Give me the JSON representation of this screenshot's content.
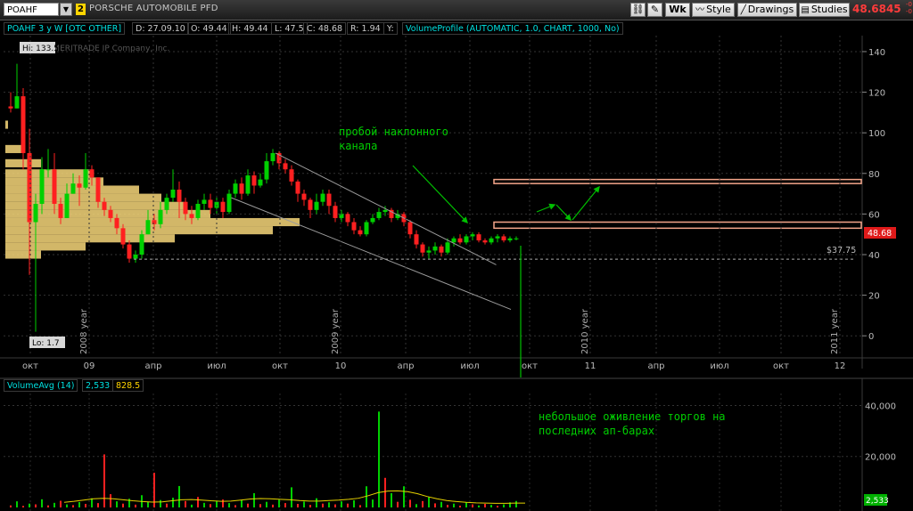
{
  "toolbar": {
    "symbol": "POAHF",
    "link_number": "2",
    "company_name": "PORSCHE AUTOMOBILE PFD",
    "buttons": {
      "wk": "Wk",
      "style": "Style",
      "drawings": "Drawings",
      "studies": "Studies"
    },
    "last_price": "48.6845",
    "change_small_top": "-0",
    "change_small_bottom": "-0"
  },
  "infobar": {
    "symbol_label": "POAHF 3 y W [OTC OTHER]",
    "date": "D: 27.09.10",
    "open": "O: 49.44",
    "high": "H: 49.44",
    "low": "L: 47.5",
    "close": "C: 48.68",
    "range": "R: 1.94",
    "y": "Y:",
    "study": "VolumeProfile (AUTOMATIC, 1.0, CHART, 1000, No)"
  },
  "colors": {
    "up": "#00d000",
    "down": "#ff2020",
    "profile": "#f7d77a",
    "channel": "#9a9a9a",
    "arrow": "#00c000",
    "zone": "#f4a58a"
  },
  "chart_data": [
    {
      "type": "candlestick",
      "title": "",
      "watermark": "© TD AMERITRADE IP Company, Inc.",
      "y_axis": {
        "ticks": [
          0,
          20,
          40,
          60,
          80,
          100,
          120,
          140
        ],
        "ylim": [
          -10,
          147
        ],
        "side": "right"
      },
      "x_axis": {
        "tick_labels": [
          "окт",
          "09",
          "апр",
          "июл",
          "окт",
          "10",
          "апр",
          "июл",
          "окт",
          "11",
          "апр",
          "июл",
          "окт",
          "12"
        ],
        "year_labels": [
          "2008 year",
          "2009 year",
          "2010 year",
          "2011 year"
        ]
      },
      "hi_label": "Hi: 133.5",
      "lo_label": "Lo: 1.7",
      "price_label": "48.68",
      "support_label": "$37.75",
      "support_value": 37.75,
      "channel_upper": {
        "from": [
          90,
          90
        ],
        "to": [
          165,
          35
        ]
      },
      "channel_lower": {
        "from": [
          75,
          68
        ],
        "to": [
          170,
          13
        ]
      },
      "resistance_zones": [
        [
          75,
          77
        ],
        [
          53,
          56
        ]
      ],
      "annotation_1": "пробой наклонного",
      "annotation_2": "канала",
      "candles": [
        [
          113,
          112,
          120,
          110
        ],
        [
          112,
          118,
          134,
          112
        ],
        [
          118,
          90,
          122,
          82
        ],
        [
          90,
          56,
          102,
          30
        ],
        [
          56,
          65,
          70,
          2
        ],
        [
          65,
          82,
          88,
          60
        ],
        [
          82,
          82,
          92,
          78
        ],
        [
          82,
          65,
          90,
          60
        ],
        [
          65,
          58,
          68,
          55
        ],
        [
          58,
          70,
          75,
          58
        ],
        [
          70,
          75,
          80,
          70
        ],
        [
          75,
          73,
          79,
          64
        ],
        [
          73,
          82,
          90,
          72
        ],
        [
          82,
          78,
          84,
          74
        ],
        [
          78,
          66,
          78,
          63
        ],
        [
          66,
          62,
          68,
          59
        ],
        [
          62,
          58,
          64,
          56
        ],
        [
          58,
          53,
          60,
          50
        ],
        [
          53,
          45,
          55,
          43
        ],
        [
          45,
          38,
          47,
          36
        ],
        [
          38,
          40,
          42,
          36
        ],
        [
          40,
          50,
          52,
          38
        ],
        [
          50,
          57,
          62,
          50
        ],
        [
          57,
          55,
          60,
          52
        ],
        [
          55,
          62,
          66,
          53
        ],
        [
          62,
          68,
          70,
          60
        ],
        [
          68,
          72,
          82,
          66
        ],
        [
          72,
          66,
          76,
          58
        ],
        [
          66,
          60,
          68,
          57
        ],
        [
          60,
          58,
          64,
          55
        ],
        [
          58,
          65,
          67,
          57
        ],
        [
          65,
          67,
          70,
          62
        ],
        [
          67,
          63,
          70,
          60
        ],
        [
          63,
          66,
          69,
          60
        ],
        [
          66,
          61,
          68,
          58
        ],
        [
          61,
          70,
          72,
          60
        ],
        [
          70,
          75,
          77,
          68
        ],
        [
          75,
          70,
          78,
          67
        ],
        [
          70,
          79,
          82,
          69
        ],
        [
          79,
          74,
          81,
          70
        ],
        [
          74,
          77,
          80,
          73
        ],
        [
          77,
          86,
          90,
          75
        ],
        [
          86,
          90,
          92,
          84
        ],
        [
          90,
          85,
          91,
          82
        ],
        [
          85,
          82,
          87,
          80
        ],
        [
          82,
          76,
          84,
          74
        ],
        [
          76,
          70,
          77,
          66
        ],
        [
          70,
          67,
          72,
          64
        ],
        [
          67,
          62,
          68,
          58
        ],
        [
          62,
          66,
          70,
          60
        ],
        [
          66,
          70,
          72,
          64
        ],
        [
          70,
          64,
          72,
          60
        ],
        [
          64,
          58,
          66,
          56
        ],
        [
          58,
          60,
          62,
          56
        ],
        [
          60,
          56,
          61,
          54
        ],
        [
          56,
          52,
          58,
          50
        ],
        [
          52,
          50,
          54,
          49
        ],
        [
          50,
          56,
          57,
          49
        ],
        [
          56,
          58,
          60,
          55
        ],
        [
          58,
          61,
          63,
          57
        ],
        [
          61,
          62,
          64,
          59
        ],
        [
          62,
          58,
          63,
          56
        ],
        [
          58,
          60,
          62,
          57
        ],
        [
          60,
          56,
          61,
          54
        ],
        [
          56,
          50,
          57,
          48
        ],
        [
          50,
          45,
          52,
          43
        ],
        [
          45,
          41,
          46,
          39
        ],
        [
          41,
          42,
          44,
          38
        ],
        [
          42,
          44,
          46,
          40
        ],
        [
          44,
          41,
          45,
          39
        ],
        [
          41,
          46,
          48,
          40
        ],
        [
          46,
          48,
          49,
          44
        ],
        [
          48,
          46,
          50,
          45
        ],
        [
          46,
          49,
          50,
          45
        ],
        [
          49,
          50,
          51,
          47
        ],
        [
          50,
          47,
          51,
          46
        ],
        [
          47,
          46,
          48,
          45
        ],
        [
          46,
          48,
          49,
          45
        ],
        [
          48,
          49,
          50,
          46
        ],
        [
          49,
          47,
          50,
          46
        ],
        [
          47,
          48,
          49,
          46
        ],
        [
          48,
          48,
          49,
          47
        ]
      ],
      "volume_profile": [
        [
          104,
          3
        ],
        [
          92,
          18
        ],
        [
          85,
          40
        ],
        [
          80,
          95
        ],
        [
          76,
          110
        ],
        [
          72,
          150
        ],
        [
          68,
          175
        ],
        [
          64,
          200
        ],
        [
          60,
          230
        ],
        [
          56,
          330
        ],
        [
          52,
          300
        ],
        [
          48,
          190
        ],
        [
          44,
          90
        ],
        [
          40,
          40
        ]
      ]
    },
    {
      "type": "bar",
      "series_name": "VolumeAvg (14)",
      "header_value_1": "2,533",
      "header_value_2": "828.5",
      "y_axis": {
        "tick_labels": [
          "40,000",
          "20,000"
        ],
        "ticks": [
          40000,
          20000
        ],
        "ylim": [
          0,
          44000
        ]
      },
      "current_label": "2,533",
      "annotation_1": "небольшое оживление торгов на",
      "annotation_2": "последних ап-барах",
      "volumes": [
        [
          800,
          "d"
        ],
        [
          2400,
          "u"
        ],
        [
          600,
          "d"
        ],
        [
          1500,
          "u"
        ],
        [
          1200,
          "d"
        ],
        [
          3200,
          "u"
        ],
        [
          800,
          "d"
        ],
        [
          1800,
          "u"
        ],
        [
          2600,
          "d"
        ],
        [
          1200,
          "u"
        ],
        [
          900,
          "d"
        ],
        [
          2100,
          "u"
        ],
        [
          1400,
          "d"
        ],
        [
          3600,
          "u"
        ],
        [
          1700,
          "d"
        ],
        [
          20800,
          "d"
        ],
        [
          5200,
          "d"
        ],
        [
          2400,
          "u"
        ],
        [
          1500,
          "d"
        ],
        [
          3400,
          "u"
        ],
        [
          1100,
          "d"
        ],
        [
          4800,
          "u"
        ],
        [
          2100,
          "u"
        ],
        [
          13600,
          "d"
        ],
        [
          2900,
          "u"
        ],
        [
          1500,
          "d"
        ],
        [
          3800,
          "u"
        ],
        [
          8400,
          "u"
        ],
        [
          2500,
          "d"
        ],
        [
          1100,
          "u"
        ],
        [
          4100,
          "d"
        ],
        [
          1800,
          "u"
        ],
        [
          1300,
          "d"
        ],
        [
          2400,
          "u"
        ],
        [
          3100,
          "d"
        ],
        [
          1700,
          "u"
        ],
        [
          900,
          "d"
        ],
        [
          2900,
          "u"
        ],
        [
          1500,
          "d"
        ],
        [
          5600,
          "u"
        ],
        [
          1300,
          "d"
        ],
        [
          2200,
          "u"
        ],
        [
          1100,
          "d"
        ],
        [
          3000,
          "u"
        ],
        [
          1700,
          "d"
        ],
        [
          7900,
          "u"
        ],
        [
          1400,
          "d"
        ],
        [
          2300,
          "u"
        ],
        [
          1000,
          "d"
        ],
        [
          3600,
          "u"
        ],
        [
          1500,
          "d"
        ],
        [
          2000,
          "u"
        ],
        [
          1200,
          "d"
        ],
        [
          2400,
          "u"
        ],
        [
          1500,
          "d"
        ],
        [
          2800,
          "u"
        ],
        [
          900,
          "d"
        ],
        [
          8300,
          "u"
        ],
        [
          3100,
          "u"
        ],
        [
          37600,
          "u"
        ],
        [
          11600,
          "d"
        ],
        [
          5600,
          "u"
        ],
        [
          2200,
          "d"
        ],
        [
          8300,
          "u"
        ],
        [
          3000,
          "d"
        ],
        [
          1300,
          "u"
        ],
        [
          2500,
          "d"
        ],
        [
          4000,
          "u"
        ],
        [
          1600,
          "d"
        ],
        [
          2200,
          "u"
        ],
        [
          1000,
          "d"
        ],
        [
          1500,
          "u"
        ],
        [
          700,
          "d"
        ],
        [
          1900,
          "u"
        ],
        [
          1200,
          "d"
        ],
        [
          800,
          "u"
        ],
        [
          1400,
          "d"
        ],
        [
          1000,
          "u"
        ],
        [
          600,
          "d"
        ],
        [
          1200,
          "u"
        ],
        [
          2000,
          "u"
        ],
        [
          2533,
          "u"
        ]
      ],
      "avg_line": [
        2000,
        2400,
        2900,
        3400,
        3600,
        3400,
        3000,
        2600,
        2300,
        2100,
        2200,
        2600,
        3000,
        3100,
        2900,
        2600,
        2400,
        2500,
        2900,
        3300,
        3500,
        3400,
        3200,
        3000,
        2700,
        2500,
        2500,
        2700,
        2900,
        3200,
        3600,
        4600,
        5800,
        6400,
        6500,
        6200,
        5400,
        4300,
        3400,
        2700,
        2300,
        2000,
        1800,
        1700,
        1600,
        1600,
        1700,
        1700
      ]
    }
  ]
}
